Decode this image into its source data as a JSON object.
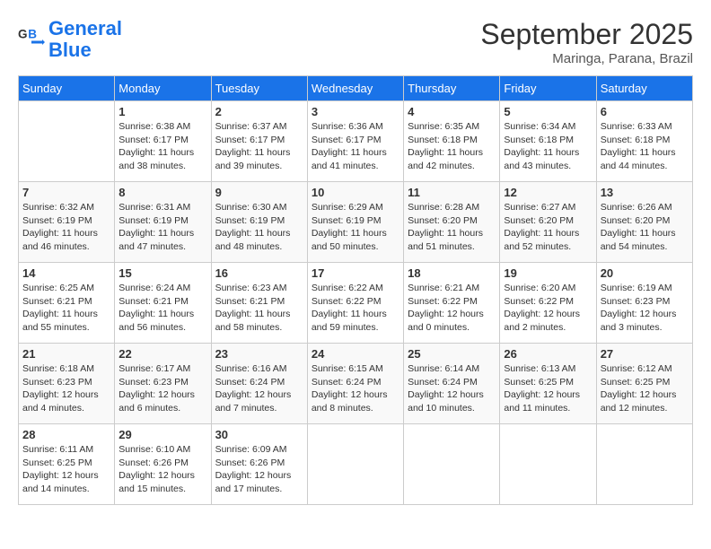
{
  "header": {
    "logo_general": "General",
    "logo_blue": "Blue",
    "month": "September 2025",
    "location": "Maringa, Parana, Brazil"
  },
  "weekdays": [
    "Sunday",
    "Monday",
    "Tuesday",
    "Wednesday",
    "Thursday",
    "Friday",
    "Saturday"
  ],
  "weeks": [
    [
      {
        "day": "",
        "sunrise": "",
        "sunset": "",
        "daylight": ""
      },
      {
        "day": "1",
        "sunrise": "Sunrise: 6:38 AM",
        "sunset": "Sunset: 6:17 PM",
        "daylight": "Daylight: 11 hours and 38 minutes."
      },
      {
        "day": "2",
        "sunrise": "Sunrise: 6:37 AM",
        "sunset": "Sunset: 6:17 PM",
        "daylight": "Daylight: 11 hours and 39 minutes."
      },
      {
        "day": "3",
        "sunrise": "Sunrise: 6:36 AM",
        "sunset": "Sunset: 6:17 PM",
        "daylight": "Daylight: 11 hours and 41 minutes."
      },
      {
        "day": "4",
        "sunrise": "Sunrise: 6:35 AM",
        "sunset": "Sunset: 6:18 PM",
        "daylight": "Daylight: 11 hours and 42 minutes."
      },
      {
        "day": "5",
        "sunrise": "Sunrise: 6:34 AM",
        "sunset": "Sunset: 6:18 PM",
        "daylight": "Daylight: 11 hours and 43 minutes."
      },
      {
        "day": "6",
        "sunrise": "Sunrise: 6:33 AM",
        "sunset": "Sunset: 6:18 PM",
        "daylight": "Daylight: 11 hours and 44 minutes."
      }
    ],
    [
      {
        "day": "7",
        "sunrise": "Sunrise: 6:32 AM",
        "sunset": "Sunset: 6:19 PM",
        "daylight": "Daylight: 11 hours and 46 minutes."
      },
      {
        "day": "8",
        "sunrise": "Sunrise: 6:31 AM",
        "sunset": "Sunset: 6:19 PM",
        "daylight": "Daylight: 11 hours and 47 minutes."
      },
      {
        "day": "9",
        "sunrise": "Sunrise: 6:30 AM",
        "sunset": "Sunset: 6:19 PM",
        "daylight": "Daylight: 11 hours and 48 minutes."
      },
      {
        "day": "10",
        "sunrise": "Sunrise: 6:29 AM",
        "sunset": "Sunset: 6:19 PM",
        "daylight": "Daylight: 11 hours and 50 minutes."
      },
      {
        "day": "11",
        "sunrise": "Sunrise: 6:28 AM",
        "sunset": "Sunset: 6:20 PM",
        "daylight": "Daylight: 11 hours and 51 minutes."
      },
      {
        "day": "12",
        "sunrise": "Sunrise: 6:27 AM",
        "sunset": "Sunset: 6:20 PM",
        "daylight": "Daylight: 11 hours and 52 minutes."
      },
      {
        "day": "13",
        "sunrise": "Sunrise: 6:26 AM",
        "sunset": "Sunset: 6:20 PM",
        "daylight": "Daylight: 11 hours and 54 minutes."
      }
    ],
    [
      {
        "day": "14",
        "sunrise": "Sunrise: 6:25 AM",
        "sunset": "Sunset: 6:21 PM",
        "daylight": "Daylight: 11 hours and 55 minutes."
      },
      {
        "day": "15",
        "sunrise": "Sunrise: 6:24 AM",
        "sunset": "Sunset: 6:21 PM",
        "daylight": "Daylight: 11 hours and 56 minutes."
      },
      {
        "day": "16",
        "sunrise": "Sunrise: 6:23 AM",
        "sunset": "Sunset: 6:21 PM",
        "daylight": "Daylight: 11 hours and 58 minutes."
      },
      {
        "day": "17",
        "sunrise": "Sunrise: 6:22 AM",
        "sunset": "Sunset: 6:22 PM",
        "daylight": "Daylight: 11 hours and 59 minutes."
      },
      {
        "day": "18",
        "sunrise": "Sunrise: 6:21 AM",
        "sunset": "Sunset: 6:22 PM",
        "daylight": "Daylight: 12 hours and 0 minutes."
      },
      {
        "day": "19",
        "sunrise": "Sunrise: 6:20 AM",
        "sunset": "Sunset: 6:22 PM",
        "daylight": "Daylight: 12 hours and 2 minutes."
      },
      {
        "day": "20",
        "sunrise": "Sunrise: 6:19 AM",
        "sunset": "Sunset: 6:23 PM",
        "daylight": "Daylight: 12 hours and 3 minutes."
      }
    ],
    [
      {
        "day": "21",
        "sunrise": "Sunrise: 6:18 AM",
        "sunset": "Sunset: 6:23 PM",
        "daylight": "Daylight: 12 hours and 4 minutes."
      },
      {
        "day": "22",
        "sunrise": "Sunrise: 6:17 AM",
        "sunset": "Sunset: 6:23 PM",
        "daylight": "Daylight: 12 hours and 6 minutes."
      },
      {
        "day": "23",
        "sunrise": "Sunrise: 6:16 AM",
        "sunset": "Sunset: 6:24 PM",
        "daylight": "Daylight: 12 hours and 7 minutes."
      },
      {
        "day": "24",
        "sunrise": "Sunrise: 6:15 AM",
        "sunset": "Sunset: 6:24 PM",
        "daylight": "Daylight: 12 hours and 8 minutes."
      },
      {
        "day": "25",
        "sunrise": "Sunrise: 6:14 AM",
        "sunset": "Sunset: 6:24 PM",
        "daylight": "Daylight: 12 hours and 10 minutes."
      },
      {
        "day": "26",
        "sunrise": "Sunrise: 6:13 AM",
        "sunset": "Sunset: 6:25 PM",
        "daylight": "Daylight: 12 hours and 11 minutes."
      },
      {
        "day": "27",
        "sunrise": "Sunrise: 6:12 AM",
        "sunset": "Sunset: 6:25 PM",
        "daylight": "Daylight: 12 hours and 12 minutes."
      }
    ],
    [
      {
        "day": "28",
        "sunrise": "Sunrise: 6:11 AM",
        "sunset": "Sunset: 6:25 PM",
        "daylight": "Daylight: 12 hours and 14 minutes."
      },
      {
        "day": "29",
        "sunrise": "Sunrise: 6:10 AM",
        "sunset": "Sunset: 6:26 PM",
        "daylight": "Daylight: 12 hours and 15 minutes."
      },
      {
        "day": "30",
        "sunrise": "Sunrise: 6:09 AM",
        "sunset": "Sunset: 6:26 PM",
        "daylight": "Daylight: 12 hours and 17 minutes."
      },
      {
        "day": "",
        "sunrise": "",
        "sunset": "",
        "daylight": ""
      },
      {
        "day": "",
        "sunrise": "",
        "sunset": "",
        "daylight": ""
      },
      {
        "day": "",
        "sunrise": "",
        "sunset": "",
        "daylight": ""
      },
      {
        "day": "",
        "sunrise": "",
        "sunset": "",
        "daylight": ""
      }
    ]
  ]
}
